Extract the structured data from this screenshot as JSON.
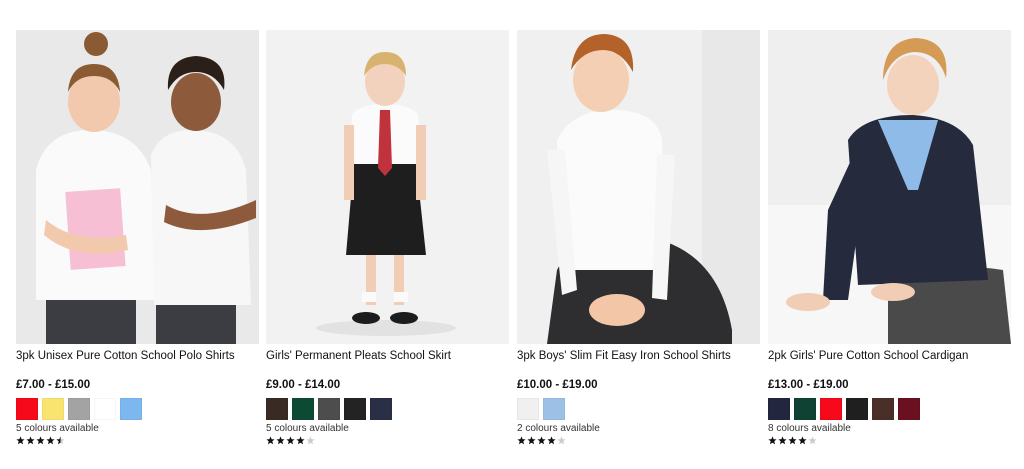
{
  "products": [
    {
      "title": "3pk Unisex Pure Cotton School Polo Shirts",
      "price": "£7.00 - £15.00",
      "colours_text": "5 colours available",
      "rating": 4.5,
      "photo_icon": "school-polo-shirts-photo",
      "swatches": [
        "#f5091a",
        "#f9e46f",
        "#a3a3a3",
        "#ffffff",
        "#7db7ef"
      ]
    },
    {
      "title": "Girls' Permanent Pleats School Skirt",
      "price": "£9.00 - £14.00",
      "colours_text": "5 colours available",
      "rating": 4,
      "photo_icon": "school-skirt-photo",
      "swatches": [
        "#3a2a24",
        "#0c4a33",
        "#4d4d4d",
        "#232323",
        "#2a2f45"
      ]
    },
    {
      "title": "3pk Boys' Slim Fit Easy Iron School Shirts",
      "price": "£10.00 - £19.00",
      "colours_text": "2 colours available",
      "rating": 4,
      "photo_icon": "school-shirts-photo",
      "swatches": [
        "#f0f0f0",
        "#9cc0e6"
      ]
    },
    {
      "title": "2pk Girls' Pure Cotton School Cardigan",
      "price": "£13.00 - £19.00",
      "colours_text": "8 colours available",
      "rating": 4,
      "photo_icon": "school-cardigan-photo",
      "swatches": [
        "#23263f",
        "#0f4232",
        "#f5091a",
        "#1f1f1f",
        "#4a2f28",
        "#6b1020"
      ]
    }
  ],
  "colors": {
    "star_filled": "#111111",
    "star_empty": "#cccccc",
    "photo_bg": "#ececec"
  }
}
